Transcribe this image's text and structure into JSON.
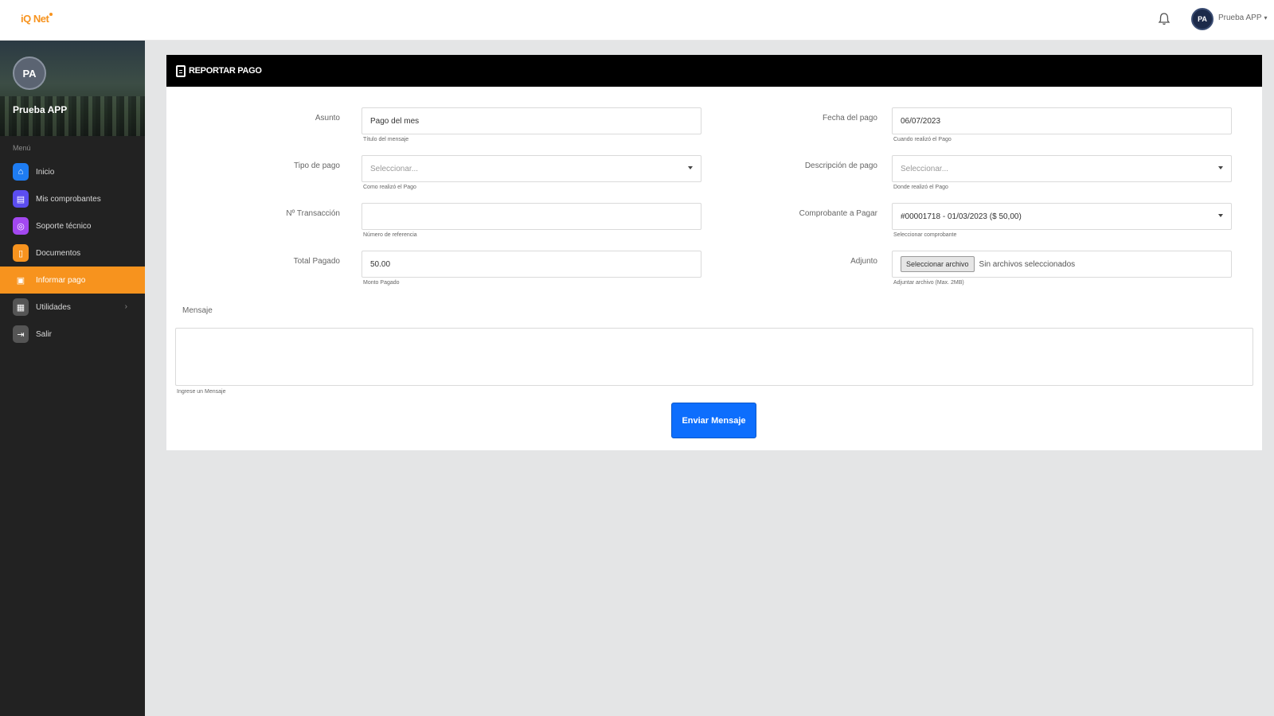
{
  "header": {
    "logo": "iQ Net",
    "user_initials": "PA",
    "user_name": "Prueba APP"
  },
  "sidebar": {
    "avatar_initials": "PA",
    "user_name": "Prueba APP",
    "section_label": "Menú",
    "items": [
      {
        "label": "Inicio",
        "icon": "home-icon",
        "color": "#1e7cf2"
      },
      {
        "label": "Mis comprobantes",
        "icon": "receipt-icon",
        "color": "#5b4df0"
      },
      {
        "label": "Soporte técnico",
        "icon": "support-icon",
        "color": "#a348f0"
      },
      {
        "label": "Documentos",
        "icon": "document-icon",
        "color": "#f7931e"
      },
      {
        "label": "Informar pago",
        "icon": "payment-icon",
        "color": "#f7931e",
        "active": true
      },
      {
        "label": "Utilidades",
        "icon": "briefcase-icon",
        "color": "#555555",
        "has_submenu": true
      },
      {
        "label": "Salir",
        "icon": "logout-icon",
        "color": "#555555"
      }
    ]
  },
  "card": {
    "title": "REPORTAR PAGO",
    "fields": {
      "asunto": {
        "label": "Asunto",
        "value": "Pago del mes",
        "help": "Título del mensaje"
      },
      "fecha_pago": {
        "label": "Fecha del pago",
        "value": "06/07/2023",
        "help": "Cuando realizó el Pago"
      },
      "tipo_pago": {
        "label": "Tipo de pago",
        "placeholder": "Seleccionar...",
        "help": "Como realizó el Pago"
      },
      "descripcion_pago": {
        "label": "Descripción de pago",
        "placeholder": "Seleccionar...",
        "help": "Donde realizó el Pago"
      },
      "transaccion": {
        "label": "Nº Transacción",
        "value": "",
        "help": "Número de referencia"
      },
      "comprobante": {
        "label": "Comprobante a Pagar",
        "value": "#00001718 - 01/03/2023 ($ 50,00)",
        "help": "Seleccionar comprobante"
      },
      "total_pagado": {
        "label": "Total Pagado",
        "value": "50.00",
        "help": "Monto Pagado"
      },
      "adjunto": {
        "label": "Adjunto",
        "button": "Seleccionar archivo",
        "status": "Sin archivos seleccionados",
        "help": "Adjuntar archivo (Max. 2MB)"
      }
    },
    "mensaje": {
      "label": "Mensaje",
      "value": "",
      "help": "Ingrese un Mensaje"
    },
    "submit_label": "Enviar Mensaje"
  },
  "colors": {
    "accent": "#f7931e",
    "primary_button": "#0d6efd",
    "sidebar_bg": "#222222",
    "card_header": "#000000"
  }
}
